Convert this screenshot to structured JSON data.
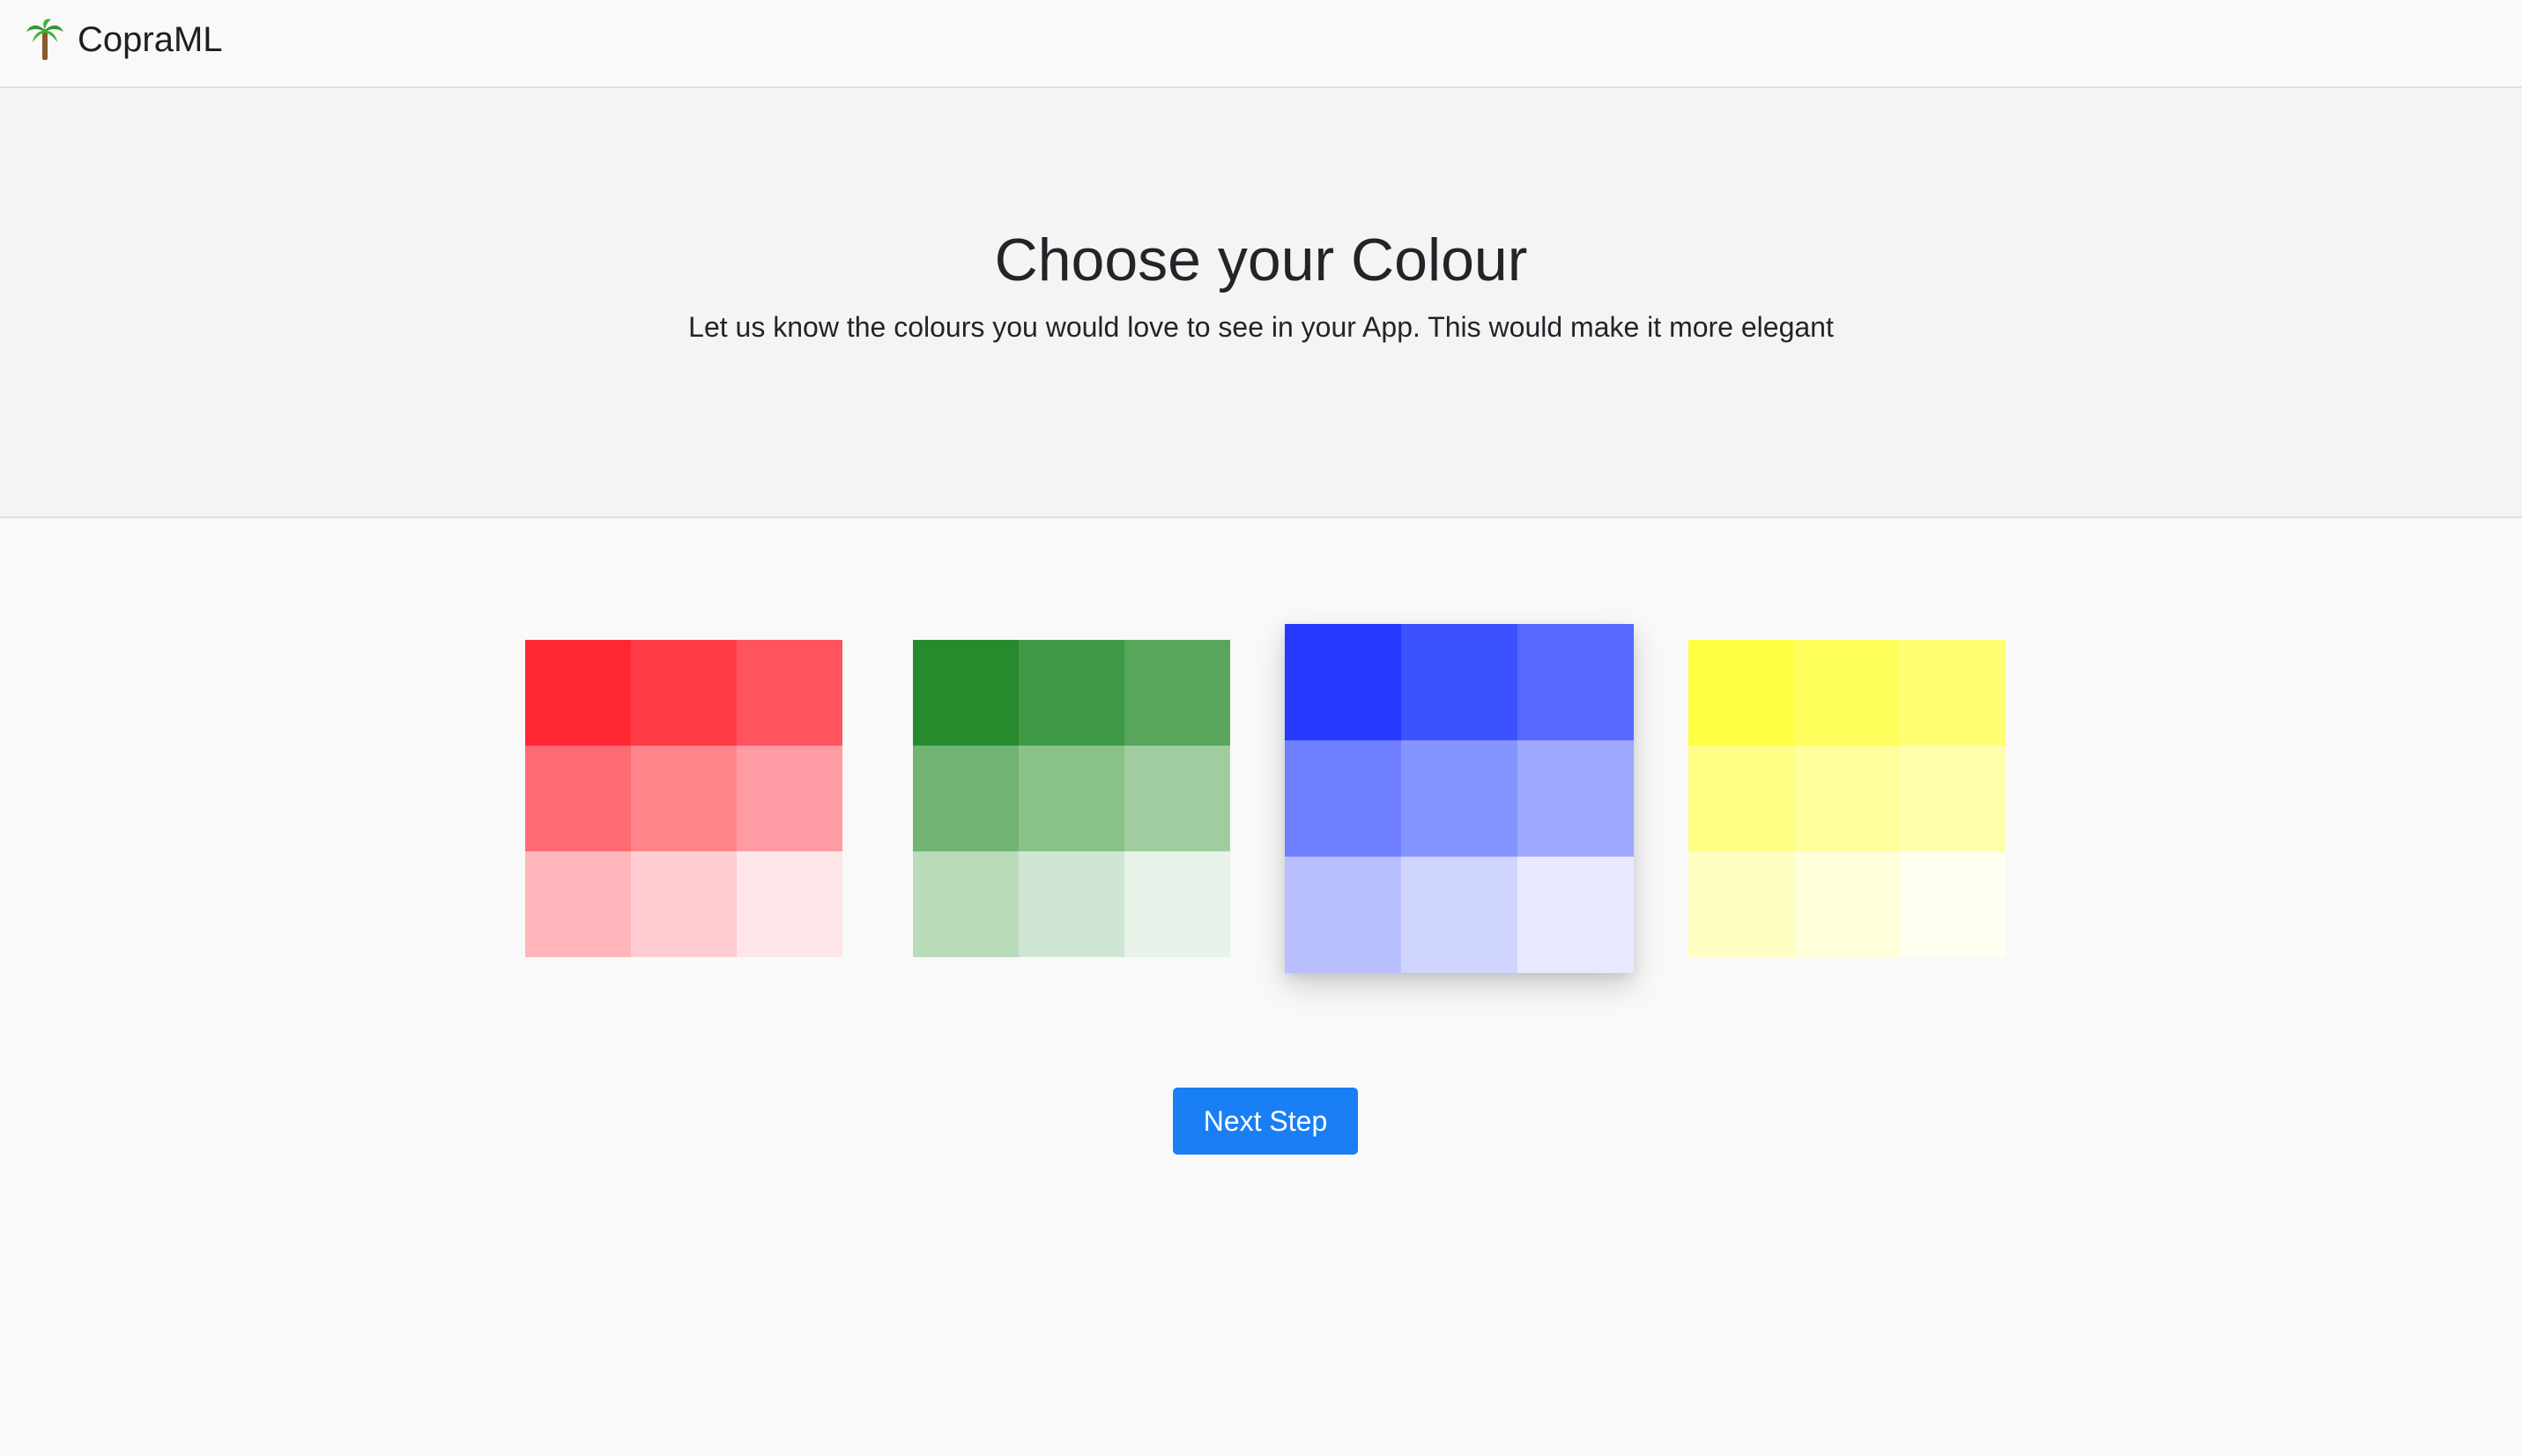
{
  "navbar": {
    "brand_icon": "palm-tree-icon",
    "brand_name": "CopraML"
  },
  "hero": {
    "title": "Choose your Colour",
    "subtitle": "Let us know the colours you would love to see in your App. This would make it more elegant"
  },
  "palettes": [
    {
      "name": "red",
      "selected": false,
      "swatches": [
        "#ff2732",
        "#ff3c45",
        "#ff5460",
        "#ff6b73",
        "#ff858b",
        "#ff9ca3",
        "#ffb5b9",
        "#ffcdd1",
        "#ffe6e9"
      ]
    },
    {
      "name": "green",
      "selected": false,
      "swatches": [
        "#278b2d",
        "#409a45",
        "#58a65c",
        "#72b474",
        "#8bc28a",
        "#a0cda0",
        "#b9dbb9",
        "#d0e6d4",
        "#e8f3ea"
      ]
    },
    {
      "name": "blue",
      "selected": true,
      "swatches": [
        "#2539fe",
        "#3c51ff",
        "#5569ff",
        "#6f7fff",
        "#8694ff",
        "#9ea9ff",
        "#b8bfff",
        "#cfd4ff",
        "#e7eaff"
      ]
    },
    {
      "name": "yellow",
      "selected": false,
      "swatches": [
        "#ffff44",
        "#ffff5c",
        "#ffff74",
        "#ffff86",
        "#ffff9c",
        "#ffffac",
        "#ffffc2",
        "#ffffda",
        "#fffff0"
      ]
    }
  ],
  "actions": {
    "next_label": "Next Step",
    "primary_color": "#1a7ff5"
  }
}
